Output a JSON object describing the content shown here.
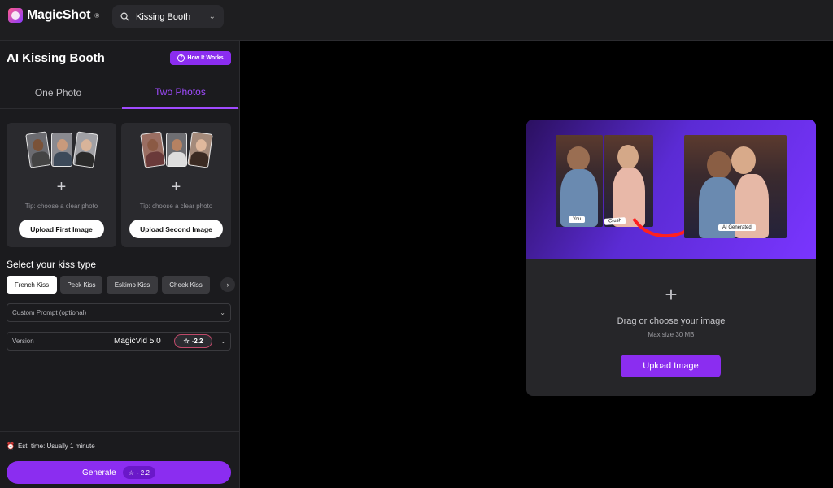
{
  "brand": {
    "name": "MagicShot",
    "reg": "®"
  },
  "search": {
    "value": "Kissing Booth",
    "icon": "search-icon"
  },
  "panel": {
    "title": "AI Kissing Booth",
    "how_it_works": "How It Works",
    "tabs": [
      "One Photo",
      "Two Photos"
    ],
    "active_tab": "Two Photos"
  },
  "uploads": {
    "first": {
      "tip": "Tip: choose a clear photo",
      "button": "Upload First Image"
    },
    "second": {
      "tip": "Tip: choose a clear photo",
      "button": "Upload Second Image"
    }
  },
  "kiss": {
    "label": "Select your kiss type",
    "types": [
      "French Kiss",
      "Peck Kiss",
      "Eskimo Kiss",
      "Cheek Kiss"
    ],
    "selected": "French Kiss"
  },
  "custom_prompt": {
    "placeholder": "Custom Prompt (optional)"
  },
  "version": {
    "label": "Version",
    "value": "MagicVid 5.0",
    "cost": "-2.2"
  },
  "footer": {
    "est_time": "Est. time: Usually 1 minute",
    "generate": "Generate",
    "cost": "- 2.2"
  },
  "dropzone": {
    "tag_you": "You",
    "tag_crush": "Crush",
    "tag_ai": "AI Generated",
    "title": "Drag or choose your image",
    "max_size": "Max size 30 MB",
    "button": "Upload Image"
  },
  "colors": {
    "accent": "#8b2df0",
    "tab_active": "#a04bff"
  }
}
